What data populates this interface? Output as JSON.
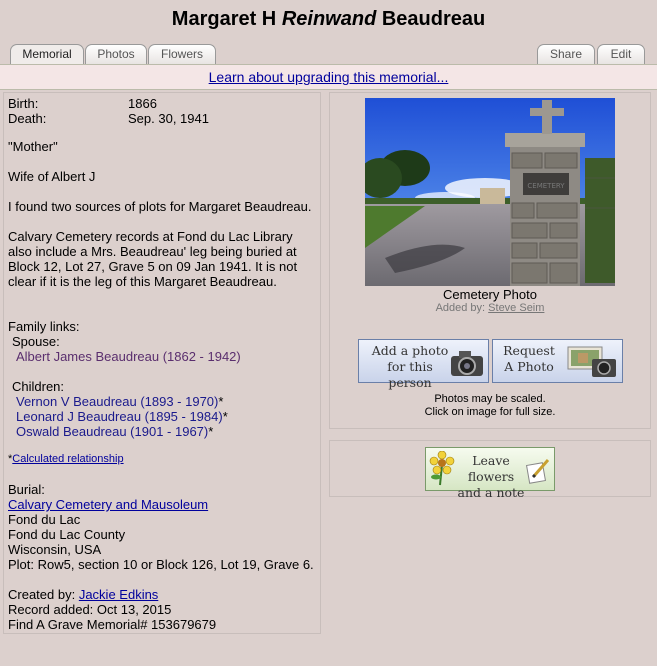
{
  "header": {
    "first": "Margaret H",
    "maiden": "Reinwand",
    "last": "Beaudreau"
  },
  "tabs": [
    {
      "label": "Memorial"
    },
    {
      "label": "Photos"
    },
    {
      "label": "Flowers"
    },
    {
      "label": "Share"
    },
    {
      "label": "Edit"
    }
  ],
  "banner": {
    "link": "Learn about upgrading this memorial..."
  },
  "vitals": {
    "birth_label": "Birth:",
    "birth_value": "1866",
    "death_label": "Death:",
    "death_value": "Sep. 30, 1941"
  },
  "bio": {
    "p1": "\"Mother\"",
    "p2": "Wife of Albert J",
    "p3": "I found two sources of plots for Margaret Beaudreau.",
    "p4": "Calvary Cemetery records at Fond du Lac Library also include a Mrs. Beaudreau' leg being buried at Block 12, Lot 27, Grave 5 on 09 Jan 1941. It is not clear if it is the leg of this Margaret Beaudreau."
  },
  "family": {
    "heading": "Family links:",
    "spouse_label": "Spouse:",
    "spouse": "Albert James Beaudreau (1862 - 1942)",
    "children_label": "Children:",
    "children": [
      {
        "name": "Vernon V Beaudreau (1893 - 1970)",
        "mark": "*"
      },
      {
        "name": "Leonard J Beaudreau (1895 - 1984)",
        "mark": "*"
      },
      {
        "name": "Oswald Beaudreau (1901 - 1967)",
        "mark": "*"
      }
    ],
    "calc_prefix": "*",
    "calc_link": "Calculated relationship"
  },
  "burial": {
    "label": "Burial:",
    "cemetery": "Calvary Cemetery and Mausoleum",
    "city": "Fond du Lac",
    "county": "Fond du Lac County",
    "state": "Wisconsin, USA",
    "plot": "Plot: Row5, section 10 or Block 126, Lot 19, Grave 6."
  },
  "record": {
    "created_label": "Created by:",
    "created_by": "Jackie Edkins",
    "added": "Record added: Oct 13, 2015",
    "memorial": "Find A Grave Memorial# 153679679"
  },
  "photo": {
    "caption": "Cemetery Photo",
    "added_label": "Added by:",
    "added_by": "Steve Seim",
    "sign_text": "CEMETERY"
  },
  "buttons": {
    "add_photo_l1": "Add a photo",
    "add_photo_l2": "for this person",
    "request_l1": "Request",
    "request_l2": "A Photo",
    "note1": "Photos may be scaled.",
    "note2": "Click on image for full size.",
    "flowers_l1": "Leave flowers",
    "flowers_l2": "and a note"
  }
}
